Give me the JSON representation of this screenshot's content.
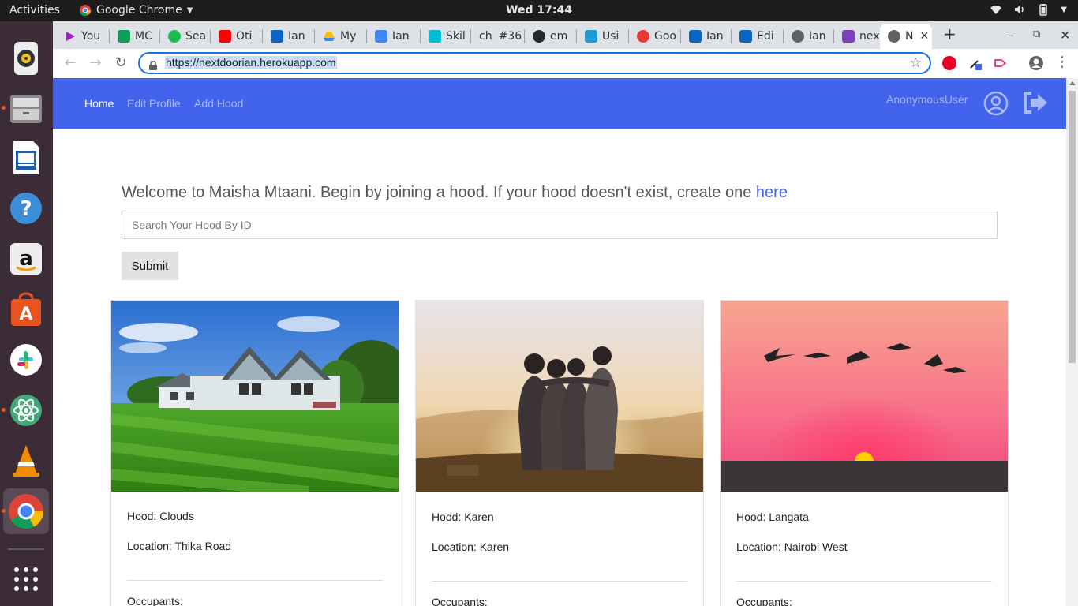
{
  "topbar": {
    "activities": "Activities",
    "app_name": "Google Chrome",
    "clock": "Wed 17:44"
  },
  "tabs": [
    {
      "label": "You",
      "color": "#ff0000"
    },
    {
      "label": "MC",
      "color": "#0f9d58"
    },
    {
      "label": "Sea",
      "color": "#1db954"
    },
    {
      "label": "Oti",
      "color": "#ff0000"
    },
    {
      "label": "Ian",
      "color": "#0a66c2"
    },
    {
      "label": "My",
      "color": "#fbbc04"
    },
    {
      "label": "Ian",
      "color": "#4285f4"
    },
    {
      "label": "Skil",
      "color": "#00bcd4"
    },
    {
      "label": "#36",
      "color": "#333333"
    },
    {
      "label": "em",
      "color": "#24292e"
    },
    {
      "label": "Usi",
      "color": "#1b9bd1"
    },
    {
      "label": "Goo",
      "color": "#e53935"
    },
    {
      "label": "Ian",
      "color": "#0a66c2"
    },
    {
      "label": "Edi",
      "color": "#0a66c2"
    },
    {
      "label": "Ian",
      "color": "#5f6368"
    },
    {
      "label": "nex",
      "color": "#7b42bc"
    },
    {
      "label": "N",
      "color": "#5f6368"
    }
  ],
  "tab_prefix_ch": "ch",
  "url": "https://nextdoorian.herokuapp.com",
  "nav": {
    "home": "Home",
    "edit_profile": "Edit Profile",
    "add_hood": "Add Hood",
    "user": "AnonymousUser"
  },
  "welcome": {
    "text": "Welcome to Maisha Mtaani. Begin by joining a hood. If your hood doesn't exist, create one ",
    "link": "here"
  },
  "search": {
    "placeholder": "Search Your Hood By ID"
  },
  "submit_label": "Submit",
  "hoods": [
    {
      "hood": "Hood: Clouds",
      "location": "Location: Thika Road",
      "occupants": "Occupants:"
    },
    {
      "hood": "Hood: Karen",
      "location": "Location: Karen",
      "occupants": "Occupants:"
    },
    {
      "hood": "Hood: Langata",
      "location": "Location: Nairobi West",
      "occupants": "Occupants:"
    }
  ],
  "colors": {
    "navbar": "#4263eb",
    "accent": "#4263eb"
  }
}
